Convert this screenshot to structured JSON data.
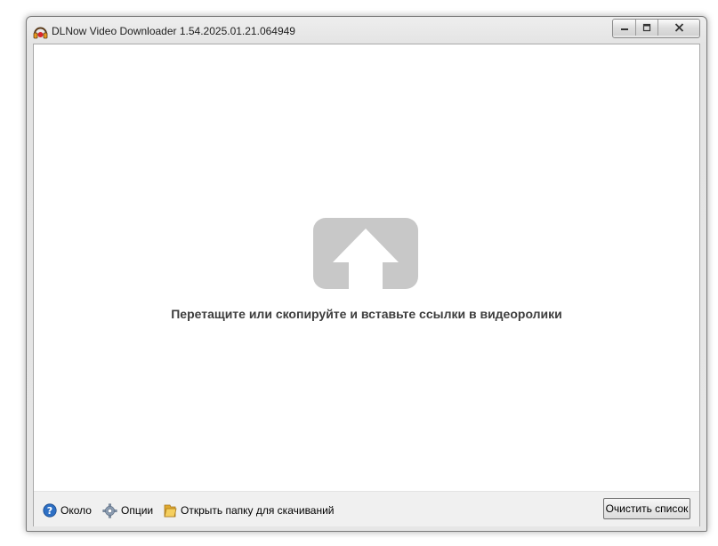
{
  "window": {
    "title": "DLNow Video Downloader 1.54.2025.01.21.064949",
    "app_icon": "headphones-app-icon",
    "caption": {
      "minimize": "minimize-icon",
      "maximize": "maximize-icon",
      "close": "close-icon"
    }
  },
  "main": {
    "drop_icon": "upload-arrow-icon",
    "drop_hint": "Перетащите или скопируйте и вставьте ссылки в видеоролики"
  },
  "toolbar": {
    "about": {
      "icon": "help-icon",
      "label": "Около"
    },
    "options": {
      "icon": "gear-icon",
      "label": "Опции"
    },
    "open_folder": {
      "icon": "folder-icon",
      "label": "Открыть папку для скачиваний"
    },
    "clear_list_label": "Очистить список"
  },
  "colors": {
    "drop_icon_gray": "#c8c8c8",
    "text_dark": "#3d3d3d",
    "toolbar_bg": "#f0f0f0"
  }
}
